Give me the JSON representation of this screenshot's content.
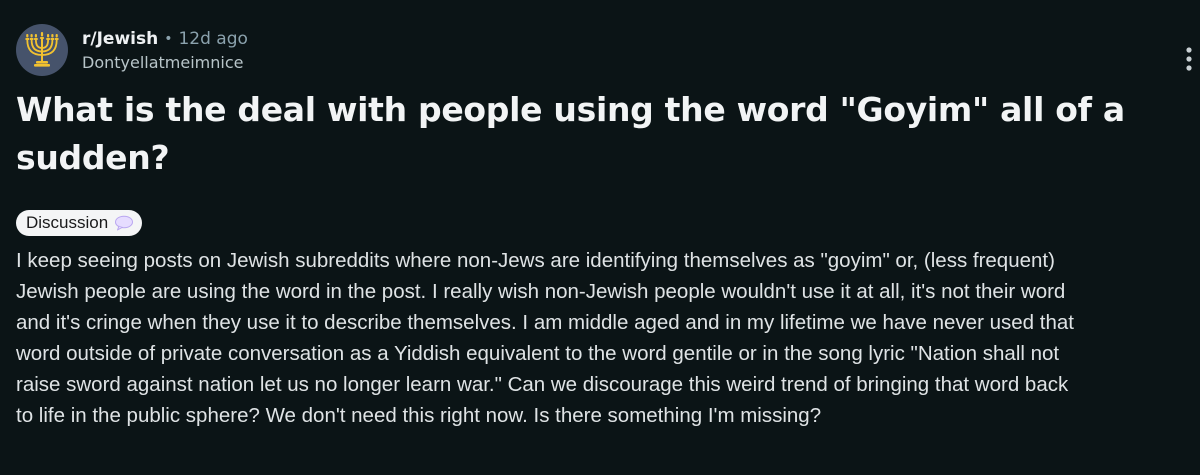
{
  "post": {
    "subreddit": "r/Jewish",
    "separator": "•",
    "age": "12d ago",
    "author": "Dontyellatmeimnice",
    "title": "What is the deal with people using the word \"Goyim\" all of a sudden?",
    "flair": {
      "label": "Discussion",
      "icon": "speech-bubble-icon"
    },
    "body_lines": [
      "I keep seeing posts on Jewish subreddits where non-Jews are identifying themselves as \"goyim\" or, (less frequent)",
      "Jewish people are using the word in the post. I really wish non-Jewish people wouldn't use it at all, it's not their word",
      "and it's cringe when they use it to describe themselves. I am middle aged and in my lifetime we have never used that",
      "word outside of private conversation as a Yiddish equivalent to the word gentile or in the song lyric \"Nation shall not",
      "raise sword against nation let us no longer learn war.\" Can we discourage this weird trend of bringing that word back",
      "to life in the public sphere? We don't need this right now. Is there something I'm missing?"
    ]
  },
  "icons": {
    "avatar": "menorah-icon",
    "overflow": "more-vertical-icon"
  },
  "colors": {
    "background": "#0b1416",
    "avatar_bg": "#46536b",
    "menorah_gold": "#f2c230",
    "flair_bg": "#f4f5f6",
    "muted_text": "#8ba2ad"
  }
}
